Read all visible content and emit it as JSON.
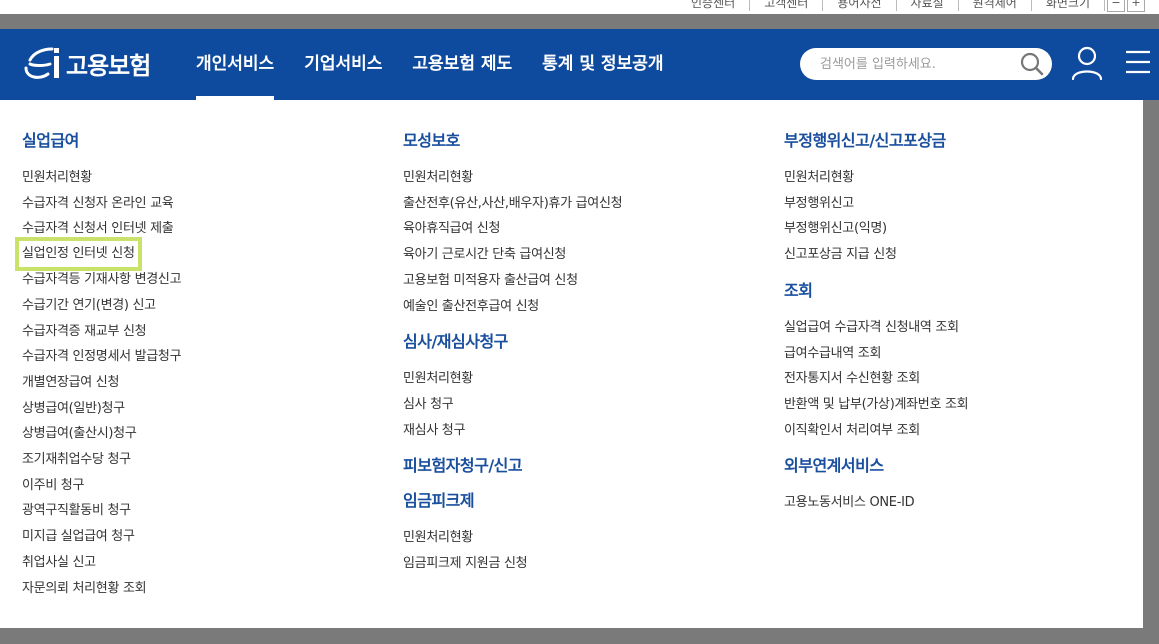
{
  "utility": {
    "links": [
      "인증센터",
      "고객센터",
      "용어사전",
      "자료실",
      "원격제어",
      "화면크기"
    ],
    "zoom_out": "−",
    "zoom_in": "+"
  },
  "header": {
    "logo_text": "고용보험",
    "nav": [
      "개인서비스",
      "기업서비스",
      "고용보험 제도",
      "통계 및 정보공개"
    ],
    "search_placeholder": "검색어를 입력하세요."
  },
  "menu": {
    "col1": {
      "title": "실업급여",
      "items": [
        "민원처리현황",
        "수급자격 신청자 온라인 교육",
        "수급자격 신청서 인터넷 제출",
        "실업인정 인터넷 신청",
        "수급자격등 기재사항 변경신고",
        "수급기간 연기(변경) 신고",
        "수급자격증 재교부 신청",
        "수급자격 인정명세서 발급청구",
        "개별연장급여 신청",
        "상병급여(일반)청구",
        "상병급여(출산시)청구",
        "조기재취업수당 청구",
        "이주비 청구",
        "광역구직활동비 청구",
        "미지급 실업급여 청구",
        "취업사실 신고",
        "자문의뢰 처리현황 조회"
      ]
    },
    "col2": {
      "sec1": {
        "title": "모성보호",
        "items": [
          "민원처리현황",
          "출산전후(유산,사산,배우자)휴가 급여신청",
          "육아휴직급여 신청",
          "육아기 근로시간 단축 급여신청",
          "고용보험 미적용자 출산급여 신청",
          "예술인 출산전후급여 신청"
        ]
      },
      "sec2": {
        "title": "심사/재심사청구",
        "items": [
          "민원처리현황",
          "심사 청구",
          "재심사 청구"
        ]
      },
      "sec3": {
        "title": "피보험자청구/신고",
        "items": []
      },
      "sec4": {
        "title": "임금피크제",
        "items": [
          "민원처리현황",
          "임금피크제 지원금 신청"
        ]
      }
    },
    "col3": {
      "sec1": {
        "title": "부정행위신고/신고포상금",
        "items": [
          "민원처리현황",
          "부정행위신고",
          "부정행위신고(익명)",
          "신고포상금 지급 신청"
        ]
      },
      "sec2": {
        "title": "조회",
        "items": [
          "실업급여 수급자격 신청내역 조회",
          "급여수급내역 조회",
          "전자통지서 수신현황 조회",
          "반환액 및 납부(가상)계좌번호 조회",
          "이직확인서 처리여부 조회"
        ]
      },
      "sec3": {
        "title": "외부연계서비스",
        "items": [
          "고용노동서비스 ONE-ID"
        ]
      }
    }
  },
  "colors": {
    "brand": "#0e4a9e",
    "highlight": "#c9e26a",
    "category": "#1a4f9e"
  }
}
